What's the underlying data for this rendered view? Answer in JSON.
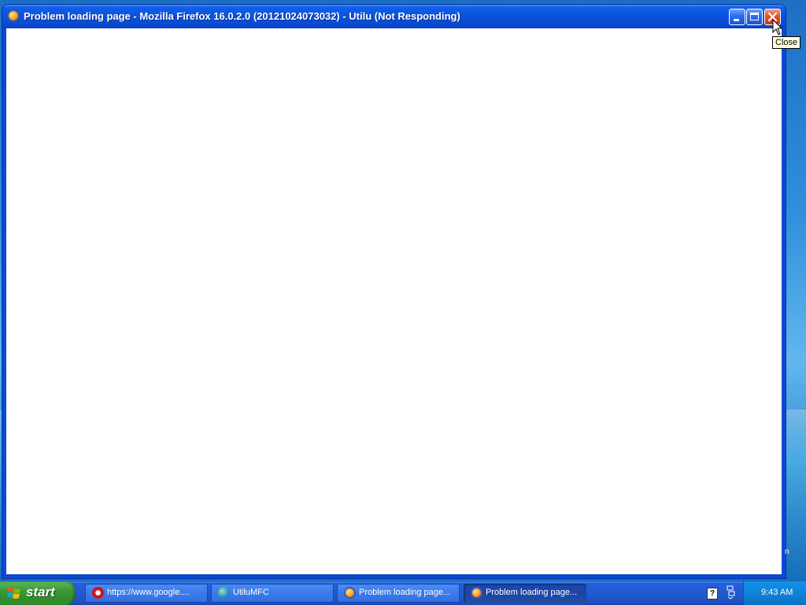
{
  "window": {
    "title": "Problem loading page - Mozilla Firefox 16.0.2.0 (20121024073032) - Utilu (Not Responding)"
  },
  "tooltip": {
    "text": "Close"
  },
  "taskbar": {
    "start_label": "start",
    "tasks": [
      {
        "label": "https://www.google....",
        "icon": "opera-icon",
        "active": false
      },
      {
        "label": "UtiluMFC",
        "icon": "globe-icon",
        "active": false
      },
      {
        "label": "Problem loading page...",
        "icon": "firefox-icon",
        "active": false
      },
      {
        "label": "Problem loading page...",
        "icon": "firefox-icon",
        "active": true
      }
    ],
    "tray_help": "?",
    "clock": "9:43 AM"
  },
  "colors": {
    "titlebar": "#0a52dc",
    "close_button": "#e2502b",
    "taskbar": "#225acf",
    "start_button": "#3c9a35",
    "tooltip_bg": "#ffffe1"
  }
}
